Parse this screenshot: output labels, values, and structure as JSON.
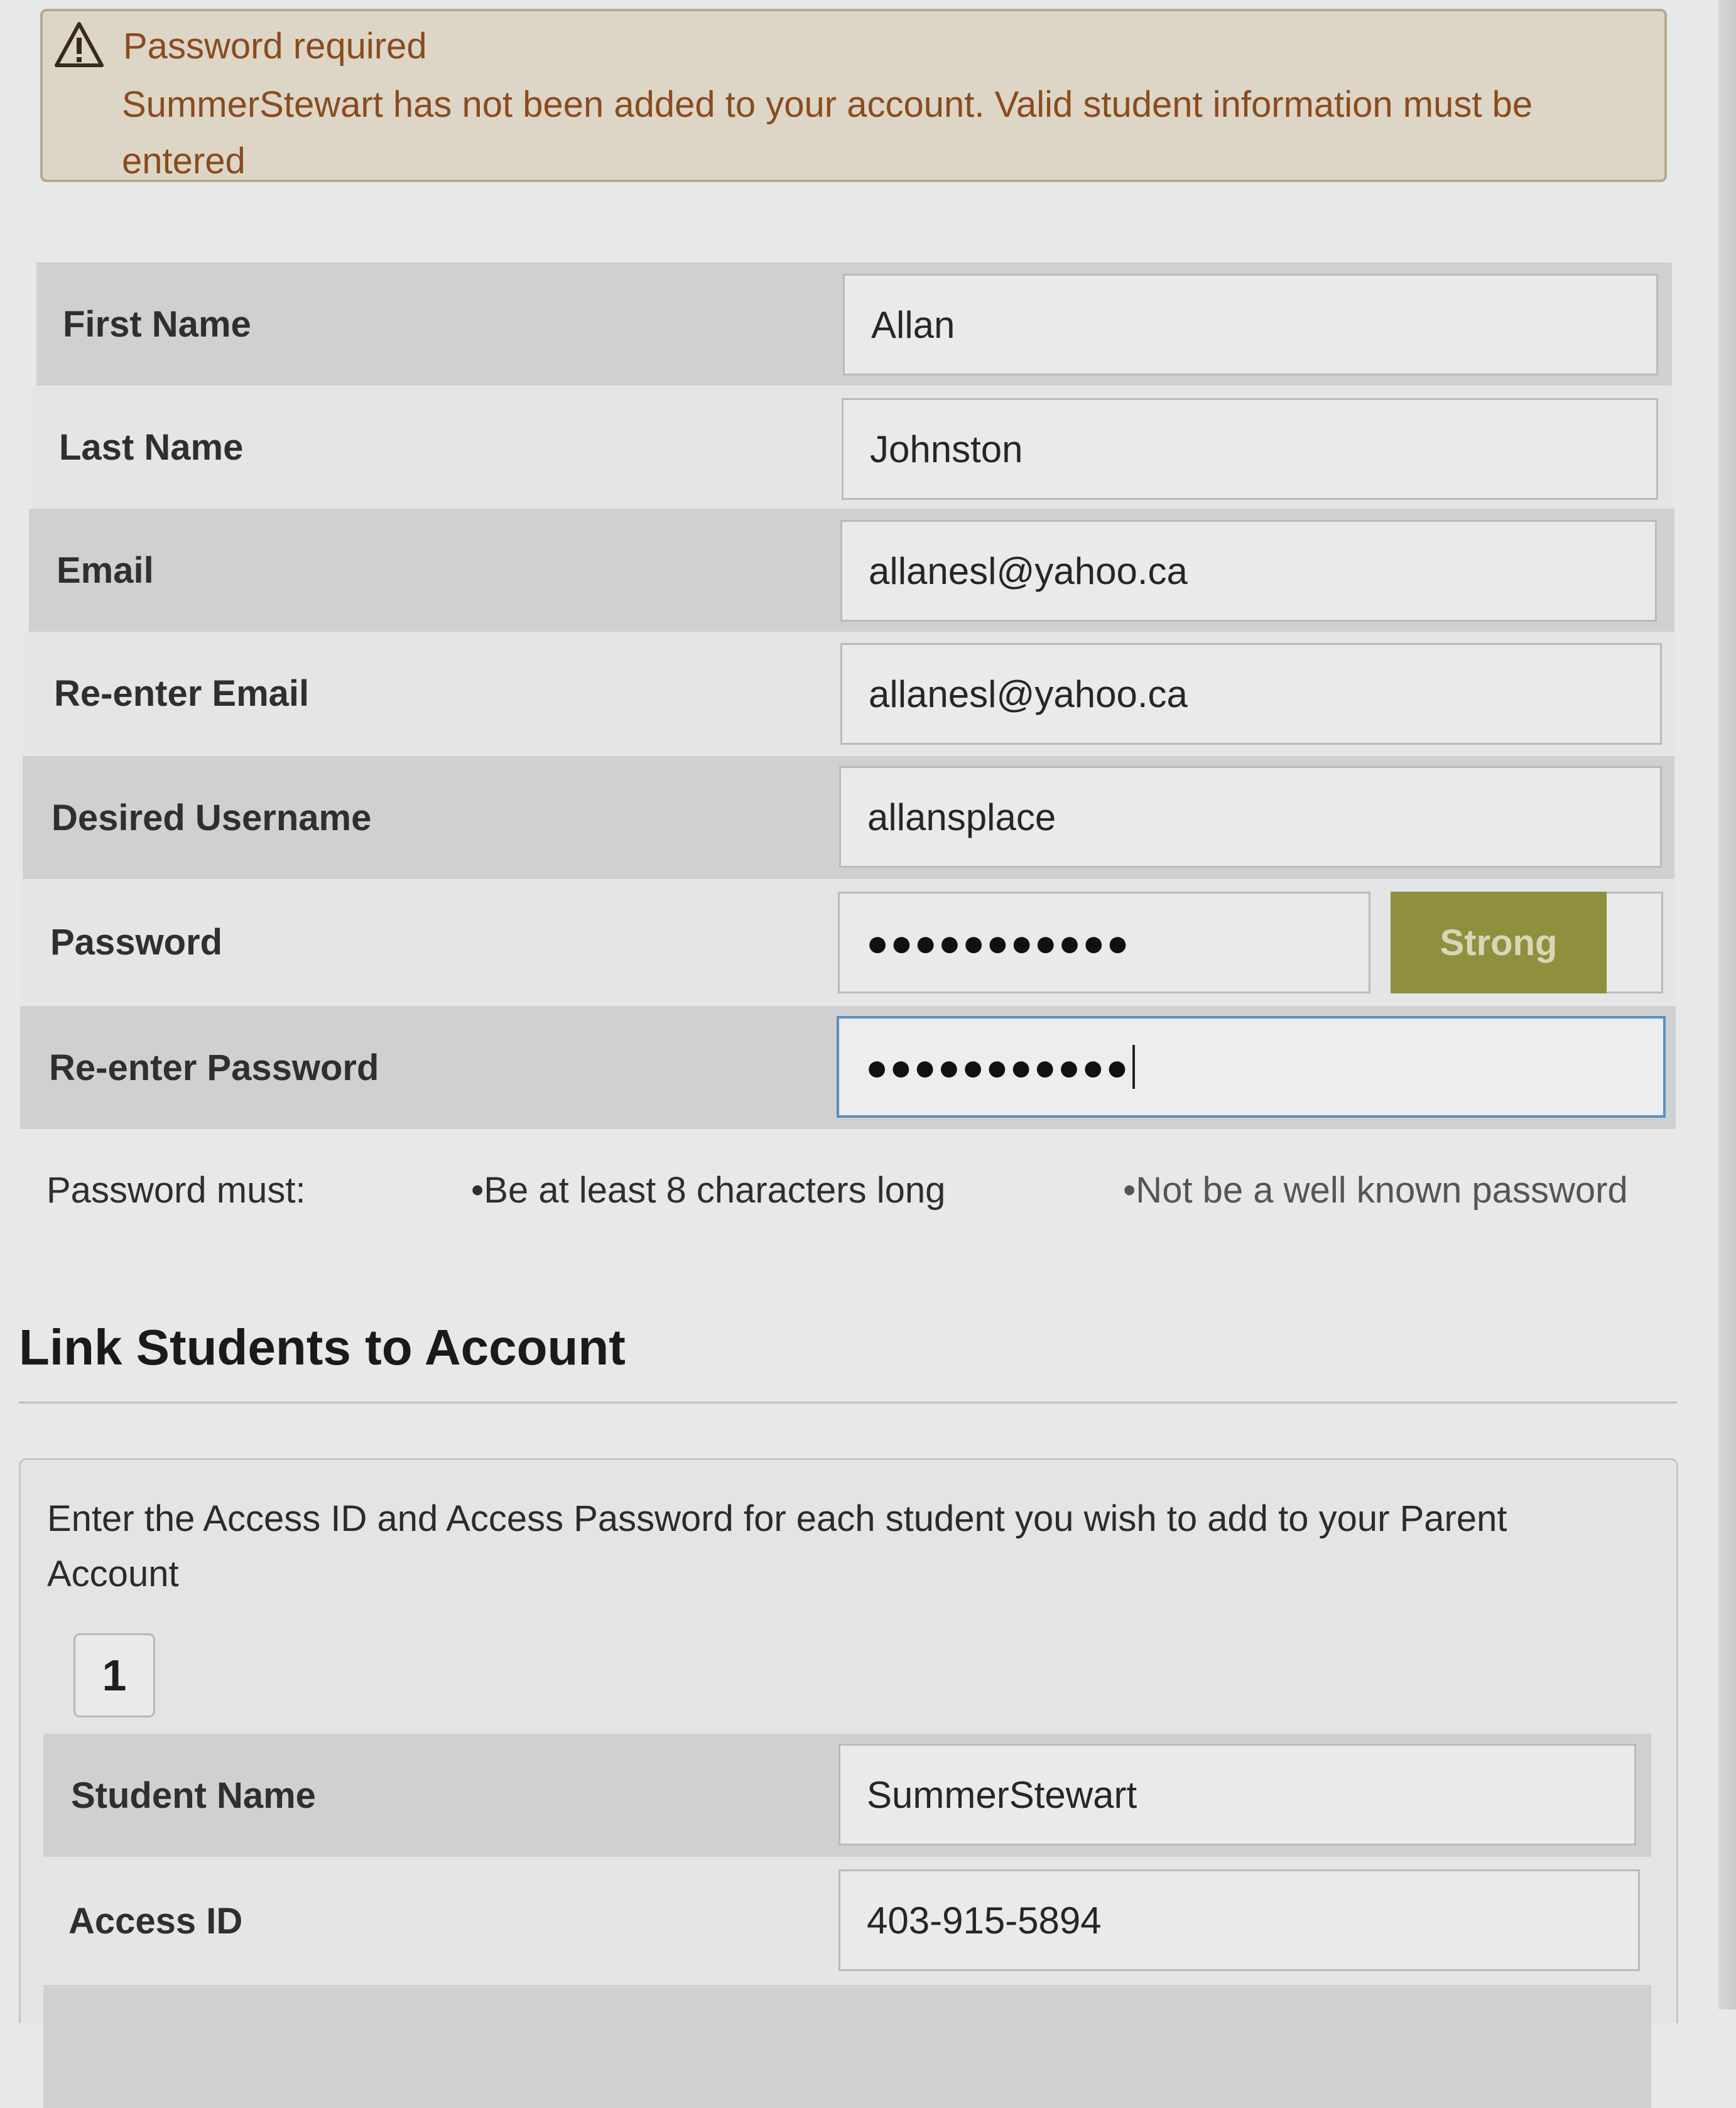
{
  "alert": {
    "icon": "warning-icon",
    "title": "Password required",
    "message": "SummerStewart has not been added to your account. Valid student information must be entered"
  },
  "form": {
    "first_name": {
      "label": "First Name",
      "value": "Allan"
    },
    "last_name": {
      "label": "Last Name",
      "value": "Johnston"
    },
    "email": {
      "label": "Email",
      "value": "allanesl@yahoo.ca"
    },
    "reenter_email": {
      "label": "Re-enter Email",
      "value": "allanesl@yahoo.ca"
    },
    "username": {
      "label": "Desired Username",
      "value": "allansplace"
    },
    "password": {
      "label": "Password",
      "value": "●●●●●●●●●●●",
      "strength": "Strong"
    },
    "reenter_password": {
      "label": "Re-enter Password",
      "value": "●●●●●●●●●●●"
    }
  },
  "password_rules": {
    "label": "Password must:",
    "rules": [
      "•Be at least 8 characters long",
      "•Not be a well known password"
    ]
  },
  "link_students": {
    "title": "Link Students to Account",
    "instructions": "Enter the Access ID and Access Password for each student you wish to add to your Parent Account",
    "student_number": "1",
    "student_name": {
      "label": "Student Name",
      "value": "SummerStewart"
    },
    "access_id": {
      "label": "Access ID",
      "value": "403-915-5894"
    }
  },
  "colors": {
    "alert_bg": "#ddd6c6",
    "alert_text": "#8a4b1f",
    "strength_badge": "#8f8f3e",
    "focus_border": "#5a8fc0"
  }
}
